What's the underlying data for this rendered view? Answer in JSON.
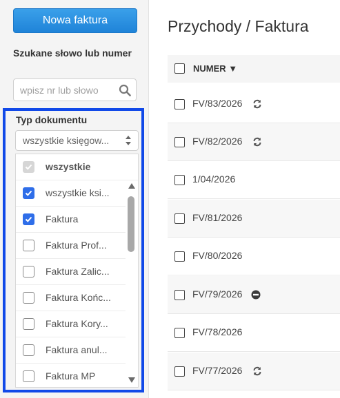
{
  "sidebar": {
    "new_invoice_label": "Nowa faktura",
    "search_label": "Szukane słowo lub numer",
    "search_placeholder": "wpisz nr lub słowo",
    "doc_type_label": "Typ dokumentu",
    "doc_type_selected": "wszystkie księgow...",
    "dropdown": {
      "select_all": {
        "label": "wszystkie",
        "checked": true,
        "disabled": true
      },
      "items": [
        {
          "label": "wszystkie ksi...",
          "checked": true
        },
        {
          "label": "Faktura",
          "checked": true
        },
        {
          "label": "Faktura Prof...",
          "checked": false
        },
        {
          "label": "Faktura Zalic...",
          "checked": false
        },
        {
          "label": "Faktura Końc...",
          "checked": false
        },
        {
          "label": "Faktura Kory...",
          "checked": false
        },
        {
          "label": "Faktura anul...",
          "checked": false
        },
        {
          "label": "Faktura MP",
          "checked": false
        }
      ]
    }
  },
  "main": {
    "title": "Przychody / Faktura",
    "column_header": "NUMER ▼",
    "rows": [
      {
        "number": "FV/83/2026",
        "icon": "sync-icon"
      },
      {
        "number": "FV/82/2026",
        "icon": "sync-icon"
      },
      {
        "number": "1/04/2026",
        "icon": ""
      },
      {
        "number": "FV/81/2026",
        "icon": ""
      },
      {
        "number": "FV/80/2026",
        "icon": ""
      },
      {
        "number": "FV/79/2026",
        "icon": "minus-circle-icon"
      },
      {
        "number": "FV/78/2026",
        "icon": ""
      },
      {
        "number": "FV/77/2026",
        "icon": "sync-icon"
      }
    ]
  },
  "colors": {
    "accent": "#1f83d8",
    "highlight_border": "#1149e8",
    "checkbox_on": "#2f6ee9"
  }
}
